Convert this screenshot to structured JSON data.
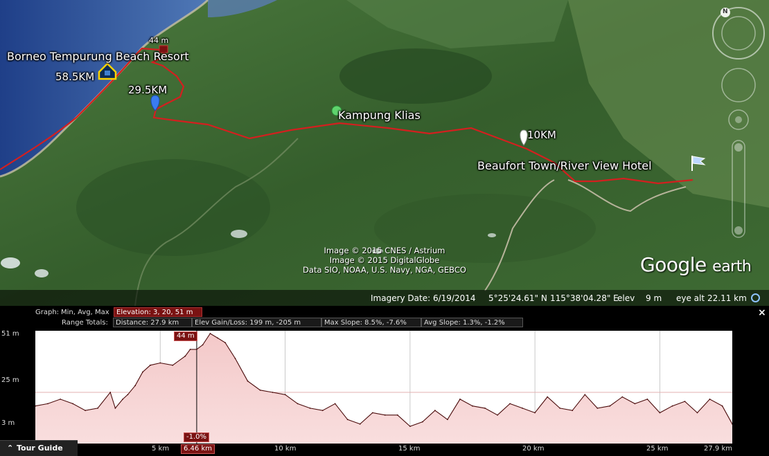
{
  "map": {
    "placemarks": {
      "resort": "Borneo Tempurung Beach Resort",
      "km585": "58.5KM",
      "km295": "29.5KM",
      "elev_marker": "44 m",
      "kampung": "Kampung Klias",
      "km10": "10KM",
      "beaufort": "Beaufort Town/River View Hotel"
    },
    "credits": {
      "line1": "Image © 2015 CNES / Astrium",
      "line2": "Image © 2015 DigitalGlobe",
      "line3": "Data SIO, NOAA, U.S. Navy, NGA, GEBCO"
    },
    "logo_google": "Google",
    "logo_earth": "earth",
    "status": {
      "imagery_date": "Imagery Date: 6/19/2014",
      "lat": "5°25'24.61\" N",
      "lon": "115°38'04.28\" E",
      "elev_label": "elev",
      "elev_value": "9 m",
      "eye_alt_label": "eye alt",
      "eye_alt_value": "22.11 km"
    },
    "compass_letter": "N",
    "colors": {
      "track": "#d41f1f",
      "land": "#3f6a35",
      "sea": "#2a4f9a"
    }
  },
  "profile": {
    "graph_label": "Graph:",
    "graph_value": "Min, Avg, Max",
    "elevation_box": "Elevation: 3, 20, 51 m",
    "range_label": "Range Totals:",
    "distance_box": "Distance: 27.9 km",
    "gain_box": "Elev Gain/Loss: 199 m, -205 m",
    "max_slope_box": "Max Slope: 8.5%, -7.6%",
    "avg_slope_box": "Avg Slope: 1.3%, -1.2%",
    "y_ticks": [
      "51 m",
      "25 m",
      "3 m"
    ],
    "x_ticks": [
      "5 km",
      "10 km",
      "15 km",
      "20 km",
      "25 km",
      "27.9 km"
    ],
    "cursor_km_label": "6.46 km",
    "cursor_elev_label": "44 m",
    "cursor_slope_label": "-1.0%",
    "close": "×",
    "tour_guide": "Tour Guide",
    "chart_data": {
      "type": "area",
      "xlabel": "",
      "ylabel": "",
      "xlim": [
        0,
        27.9
      ],
      "ylim": [
        3,
        51
      ],
      "x": [
        0,
        0.5,
        1,
        1.5,
        2,
        2.5,
        3,
        3.2,
        3.5,
        3.7,
        4,
        4.3,
        4.6,
        5,
        5.5,
        6,
        6.2,
        6.46,
        6.7,
        7,
        7.3,
        7.6,
        8,
        8.5,
        9,
        9.5,
        10,
        10.5,
        11,
        11.5,
        12,
        12.5,
        13,
        13.5,
        14,
        14.5,
        15,
        15.5,
        16,
        16.5,
        17,
        17.5,
        18,
        18.5,
        19,
        19.5,
        20,
        20.5,
        21,
        21.5,
        22,
        22.5,
        23,
        23.5,
        24,
        24.5,
        25,
        25.5,
        26,
        26.5,
        27,
        27.5,
        27.9
      ],
      "values": [
        19,
        20,
        22,
        20,
        17,
        18,
        25,
        18,
        22,
        24,
        28,
        34,
        37,
        38,
        37,
        41,
        44,
        44,
        46,
        51,
        49,
        47,
        40,
        30,
        26,
        25,
        24,
        20,
        18,
        17,
        20,
        13,
        11,
        16,
        15,
        15,
        10,
        12,
        17,
        13,
        22,
        19,
        18,
        15,
        20,
        18,
        16,
        23,
        18,
        17,
        24,
        18,
        19,
        23,
        20,
        22,
        16,
        19,
        21,
        16,
        22,
        19,
        11
      ]
    }
  }
}
